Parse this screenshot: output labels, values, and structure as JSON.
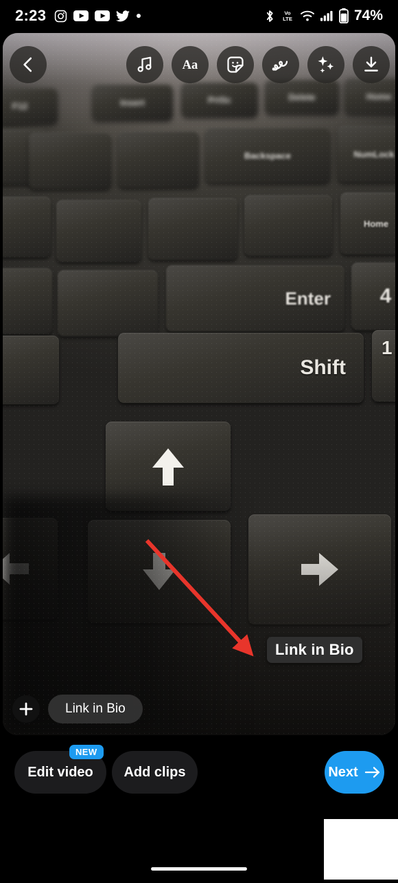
{
  "status_bar": {
    "time": "2:23",
    "battery_percent": "74%",
    "left_icons": [
      "instagram-icon",
      "youtube-icon",
      "youtube-icon",
      "twitter-icon",
      "dot-icon"
    ],
    "right_icons": [
      "bluetooth-icon",
      "volte-icon",
      "wifi-icon",
      "signal-icon",
      "battery-icon"
    ],
    "volte_label_top": "Vo",
    "volte_label_bottom": "LTE"
  },
  "editor": {
    "back_label": "Back",
    "tools": [
      {
        "name": "music-icon",
        "label": "Music"
      },
      {
        "name": "text-icon",
        "label": "Aa"
      },
      {
        "name": "sticker-icon",
        "label": "Stickers"
      },
      {
        "name": "draw-icon",
        "label": "Draw"
      },
      {
        "name": "effects-icon",
        "label": "Effects"
      },
      {
        "name": "download-icon",
        "label": "Save"
      }
    ],
    "sticker_text": "Link in Bio",
    "annotation_color": "#e8352b",
    "chip_text": "Link in Bio",
    "add_button_label": "+"
  },
  "photo": {
    "description": "Close-up photo of a dark laptop keyboard",
    "keycaps": [
      "F12",
      "Insert",
      "PrtSc",
      "Delete",
      "Home",
      "Backspace",
      "NumLock",
      "Enter",
      "4",
      "Shift",
      "?",
      "1",
      "Home"
    ]
  },
  "action_bar": {
    "edit_video_label": "Edit video",
    "edit_video_badge": "NEW",
    "add_clips_label": "Add clips",
    "next_label": "Next",
    "accent_color": "#1d9bf0"
  }
}
